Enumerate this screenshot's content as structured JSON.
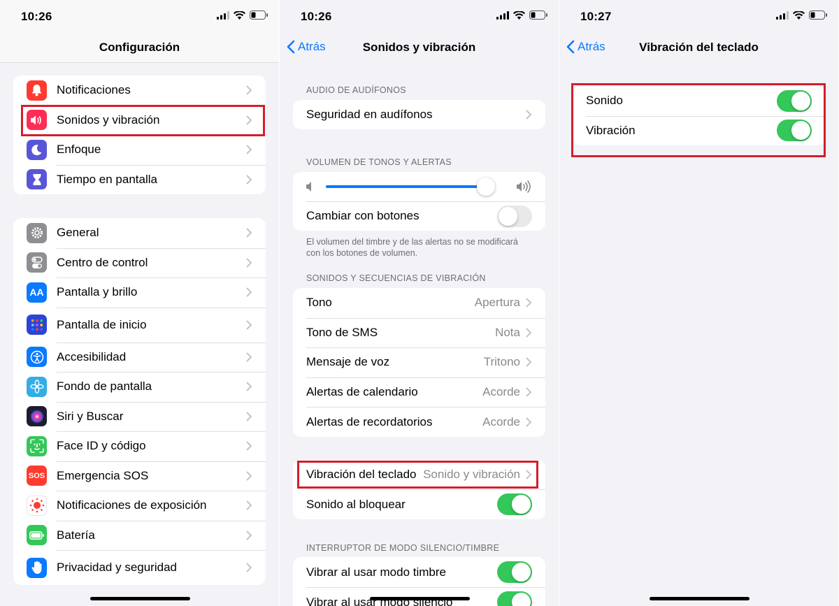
{
  "screens": [
    {
      "time": "10:26",
      "title": "Configuración",
      "groups": [
        [
          {
            "label": "Notificaciones",
            "icon": "bell-icon",
            "color": "#ff3b30"
          },
          {
            "label": "Sonidos y vibración",
            "icon": "speaker-icon",
            "color": "#ff2d55",
            "highlighted": true
          },
          {
            "label": "Enfoque",
            "icon": "moon-icon",
            "color": "#5856d6"
          },
          {
            "label": "Tiempo en pantalla",
            "icon": "hourglass-icon",
            "color": "#5856d6"
          }
        ],
        [
          {
            "label": "General",
            "icon": "gear-icon",
            "color": "#8e8e93"
          },
          {
            "label": "Centro de control",
            "icon": "toggles-icon",
            "color": "#8e8e93"
          },
          {
            "label": "Pantalla y brillo",
            "icon": "text-size-icon",
            "color": "#0a7aff",
            "glyph": "AA"
          },
          {
            "label": "Pantalla de inicio",
            "icon": "home-grid-icon",
            "color": "#2c44d6"
          },
          {
            "label": "Accesibilidad",
            "icon": "accessibility-icon",
            "color": "#0a7aff"
          },
          {
            "label": "Fondo de pantalla",
            "icon": "flower-icon",
            "color": "#32ade6"
          },
          {
            "label": "Siri y Buscar",
            "icon": "siri-icon",
            "color": "#1c1c2e"
          },
          {
            "label": "Face ID y código",
            "icon": "face-id-icon",
            "color": "#34c759"
          },
          {
            "label": "Emergencia SOS",
            "icon": "sos-icon",
            "color": "#ff3b30",
            "glyph": "SOS"
          },
          {
            "label": "Notificaciones de exposición",
            "icon": "exposure-icon",
            "color": "#ffffff"
          },
          {
            "label": "Batería",
            "icon": "battery-icon",
            "color": "#34c759"
          },
          {
            "label": "Privacidad y seguridad",
            "icon": "hand-icon",
            "color": "#0a7aff"
          }
        ]
      ]
    },
    {
      "time": "10:26",
      "back": "Atrás",
      "title": "Sonidos y vibración",
      "sections": {
        "audio_header": "AUDIO DE AUDÍFONOS",
        "audio_row": "Seguridad en audífonos",
        "volume_header": "VOLUMEN DE TONOS Y ALERTAS",
        "volume_level": 0.93,
        "change_with_buttons": "Cambiar con botones",
        "change_with_buttons_on": false,
        "volume_footnote": "El volumen del timbre y de las alertas no se modificará con los botones de volumen.",
        "sounds_header": "SONIDOS Y SECUENCIAS DE VIBRACIÓN",
        "sounds": [
          {
            "label": "Tono",
            "value": "Apertura"
          },
          {
            "label": "Tono de SMS",
            "value": "Nota"
          },
          {
            "label": "Mensaje de voz",
            "value": "Tritono"
          },
          {
            "label": "Alertas de calendario",
            "value": "Acorde"
          },
          {
            "label": "Alertas de recordatorios",
            "value": "Acorde"
          }
        ],
        "keyboard_vibration": {
          "label": "Vibración del teclado",
          "value": "Sonido y vibración"
        },
        "lock_sound": {
          "label": "Sonido al bloquear",
          "on": true
        },
        "silent_header": "INTERRUPTOR DE MODO SILENCIO/TIMBRE",
        "silent_rows": [
          {
            "label": "Vibrar al usar modo timbre",
            "on": true
          },
          {
            "label": "Vibrar al usar modo silencio",
            "on": true
          }
        ]
      }
    },
    {
      "time": "10:27",
      "back": "Atrás",
      "title": "Vibración del teclado",
      "rows": [
        {
          "label": "Sonido",
          "on": true
        },
        {
          "label": "Vibración",
          "on": true
        }
      ]
    }
  ],
  "colors": {
    "accent": "#0a7aff",
    "toggle_on": "#34c759",
    "highlight": "#d41e2c"
  }
}
